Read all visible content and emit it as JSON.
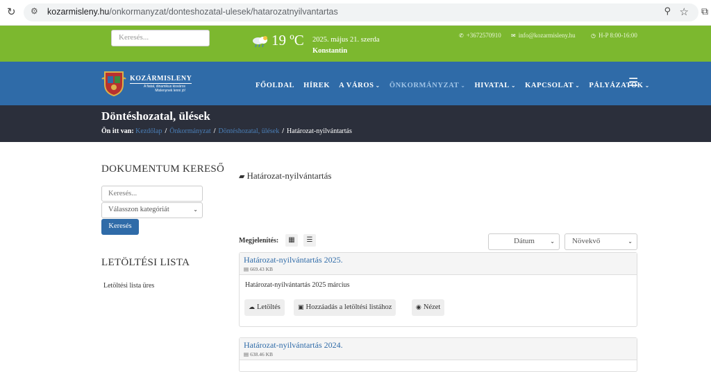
{
  "browser": {
    "url_host": "kozarmisleny.hu",
    "url_path": "/onkormanyzat/donteshozatal-ulesek/hatarozatnyilvantartas"
  },
  "topbar": {
    "search_placeholder": "Keresés...",
    "temperature": "19 ºC",
    "date": "2025. május 21. szerda",
    "nameday": "Konstantin",
    "phone": "+3672570910",
    "email": "info@kozarmisleny.hu",
    "hours": "H-P 8:00-16:00"
  },
  "logo": {
    "name": "KOZÁRMISLENY",
    "tagline": "A fiatal, dinamikus kisváros Mislenynek lenni jó!"
  },
  "nav": {
    "items": [
      {
        "label": "FŐOLDAL",
        "chevron": false,
        "active": false
      },
      {
        "label": "HÍREK",
        "chevron": false,
        "active": false
      },
      {
        "label": "A VÁROS",
        "chevron": true,
        "active": false
      },
      {
        "label": "ÖNKORMÁNYZAT",
        "chevron": true,
        "active": true
      },
      {
        "label": "HIVATAL",
        "chevron": true,
        "active": false
      },
      {
        "label": "KAPCSOLAT",
        "chevron": true,
        "active": false
      },
      {
        "label": "PÁLYÁZATOK",
        "chevron": true,
        "active": false
      }
    ]
  },
  "title": {
    "heading": "Döntéshozatal, ülések",
    "breadcrumb_label": "Ön itt van:",
    "crumbs": [
      "Kezdőlap",
      "Önkormányzat",
      "Döntéshozatal, ülések"
    ],
    "current": "Határozat-nyilvántartás"
  },
  "sidebar": {
    "doc_search_heading": "DOKUMENTUM KERESŐ",
    "search_placeholder": "Keresés...",
    "category_select": "Válasszon kategóriát",
    "search_button": "Keresés",
    "download_heading": "LETÖLTÉSI LISTA",
    "download_empty": "Letöltési lista üres"
  },
  "main": {
    "folder_title": "Határozat-nyilvántartás",
    "view_label": "Megjelenítés:",
    "sort_field": "Dátum",
    "sort_order": "Növekvő",
    "docs": [
      {
        "title": "Határozat-nyilvántartás 2025.",
        "size": "669.43 KB",
        "desc": "Határozat-nyilvántartás 2025 március"
      },
      {
        "title": "Határozat-nyilvántartás 2024.",
        "size": "638.46 KB"
      }
    ],
    "actions": {
      "download": "Letöltés",
      "add_to_list": "Hozzáadás a letöltési listához",
      "view": "Nézet"
    }
  }
}
